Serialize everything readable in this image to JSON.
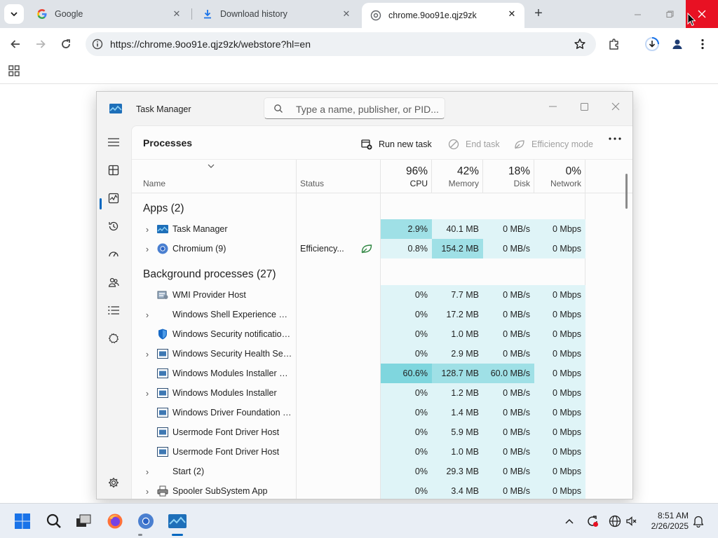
{
  "browser": {
    "tabs": [
      {
        "title": "Google",
        "active": false
      },
      {
        "title": "Download history",
        "active": false
      },
      {
        "title": "chrome.9oo91e.qjz9zk",
        "active": true
      }
    ],
    "url": "https://chrome.9oo91e.qjz9zk/webstore?hl=en"
  },
  "task_manager": {
    "title": "Task Manager",
    "search_placeholder": "Type a name, publisher, or PID...",
    "page_title": "Processes",
    "commands": {
      "run_new_task": "Run new task",
      "end_task": "End task",
      "efficiency_mode": "Efficiency mode"
    },
    "columns": {
      "name": "Name",
      "status": "Status",
      "cpu": {
        "label": "CPU",
        "percent": "96%"
      },
      "memory": {
        "label": "Memory",
        "percent": "42%"
      },
      "disk": {
        "label": "Disk",
        "percent": "18%"
      },
      "network": {
        "label": "Network",
        "percent": "0%"
      }
    },
    "groups": {
      "apps": "Apps (2)",
      "background": "Background processes (27)"
    },
    "apps": [
      {
        "name": "Task Manager",
        "status": "",
        "cpu": "2.9%",
        "memory": "40.1 MB",
        "disk": "0 MB/s",
        "network": "0 Mbps",
        "icon": "task-manager-icon"
      },
      {
        "name": "Chromium (9)",
        "status": "Efficiency...",
        "cpu": "0.8%",
        "memory": "154.2 MB",
        "disk": "0 MB/s",
        "network": "0 Mbps",
        "icon": "chromium-icon"
      }
    ],
    "background": [
      {
        "name": "WMI Provider Host",
        "cpu": "0%",
        "memory": "7.7 MB",
        "disk": "0 MB/s",
        "network": "0 Mbps",
        "icon": "wmi-icon",
        "expandable": false
      },
      {
        "name": "Windows Shell Experience Host",
        "cpu": "0%",
        "memory": "17.2 MB",
        "disk": "0 MB/s",
        "network": "0 Mbps",
        "icon": "",
        "expandable": true
      },
      {
        "name": "Windows Security notification icon",
        "cpu": "0%",
        "memory": "1.0 MB",
        "disk": "0 MB/s",
        "network": "0 Mbps",
        "icon": "shield-icon",
        "expandable": false
      },
      {
        "name": "Windows Security Health Service",
        "cpu": "0%",
        "memory": "2.9 MB",
        "disk": "0 MB/s",
        "network": "0 Mbps",
        "icon": "service-icon",
        "expandable": true
      },
      {
        "name": "Windows Modules Installer Worker",
        "cpu": "60.6%",
        "memory": "128.7 MB",
        "disk": "60.0 MB/s",
        "network": "0 Mbps",
        "icon": "service-icon",
        "expandable": false
      },
      {
        "name": "Windows Modules Installer",
        "cpu": "0%",
        "memory": "1.2 MB",
        "disk": "0 MB/s",
        "network": "0 Mbps",
        "icon": "service-icon",
        "expandable": true
      },
      {
        "name": "Windows Driver Foundation - User-mode Driver Framework Host Process",
        "cpu": "0%",
        "memory": "1.4 MB",
        "disk": "0 MB/s",
        "network": "0 Mbps",
        "icon": "service-icon",
        "expandable": false
      },
      {
        "name": "Usermode Font Driver Host",
        "cpu": "0%",
        "memory": "5.9 MB",
        "disk": "0 MB/s",
        "network": "0 Mbps",
        "icon": "service-icon",
        "expandable": false
      },
      {
        "name": "Usermode Font Driver Host",
        "cpu": "0%",
        "memory": "1.0 MB",
        "disk": "0 MB/s",
        "network": "0 Mbps",
        "icon": "service-icon",
        "expandable": false
      },
      {
        "name": "Start (2)",
        "cpu": "0%",
        "memory": "29.3 MB",
        "disk": "0 MB/s",
        "network": "0 Mbps",
        "icon": "",
        "expandable": true
      },
      {
        "name": "Spooler SubSystem App",
        "cpu": "0%",
        "memory": "3.4 MB",
        "disk": "0 MB/s",
        "network": "0 Mbps",
        "icon": "printer-icon",
        "expandable": true
      }
    ]
  },
  "taskbar": {
    "time": "8:51 AM",
    "date": "2/26/2025"
  },
  "colors": {
    "accent": "#0067c0",
    "heat_light": "#dff4f7",
    "heat_medium": "#bde9ee",
    "heat_high": "#9fe0e6",
    "heat_strong": "#7fd6de",
    "close_red": "#e81123"
  }
}
